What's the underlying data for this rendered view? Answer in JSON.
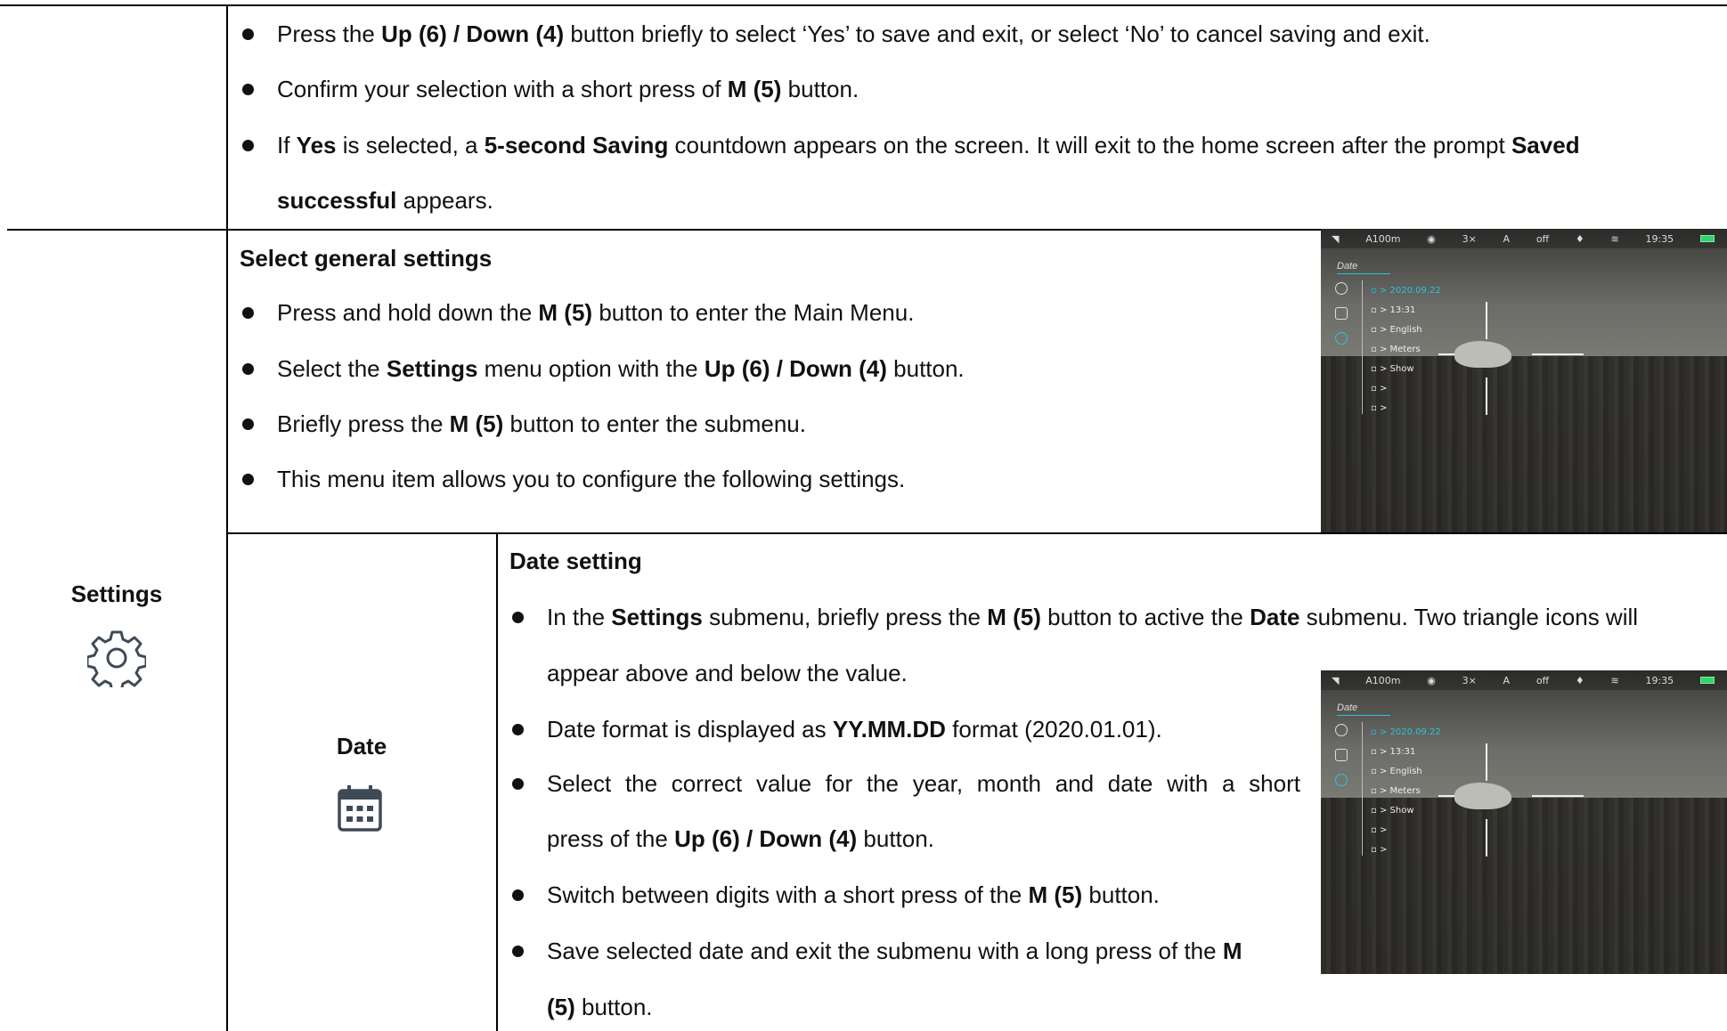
{
  "top_section": {
    "bullets": [
      [
        {
          "t": "Press the "
        },
        {
          "b": "Up (6) / Down (4)"
        },
        {
          "t": " button briefly to select ‘Yes’ to save and exit, or select ‘No’ to cancel saving and exit."
        }
      ],
      [
        {
          "t": "Confirm your selection with a short press of "
        },
        {
          "b": "M (5)"
        },
        {
          "t": " button."
        }
      ],
      [
        {
          "t": "If "
        },
        {
          "b": "Yes"
        },
        {
          "t": " is selected, a "
        },
        {
          "b": "5-second Saving"
        },
        {
          "t": " countdown appears on the screen. It will exit to the home screen after the prompt "
        },
        {
          "b": "Saved"
        }
      ],
      [
        {
          "b": "successful"
        },
        {
          "t": " appears."
        }
      ]
    ]
  },
  "settings_row": {
    "label": "Settings",
    "icon": "gear-icon",
    "general": {
      "heading": "Select general settings",
      "bullets": [
        [
          {
            "t": "Press and hold down the "
          },
          {
            "b": "M (5)"
          },
          {
            "t": " button to enter the Main Menu."
          }
        ],
        [
          {
            "t": "Select the "
          },
          {
            "b": "Settings"
          },
          {
            "t": " menu option with the "
          },
          {
            "b": "Up (6) / Down (4)"
          },
          {
            "t": " button."
          }
        ],
        [
          {
            "t": "Briefly press the "
          },
          {
            "b": "M (5)"
          },
          {
            "t": " button to enter the submenu."
          }
        ],
        [
          {
            "t": "This menu item allows you to configure the following settings."
          }
        ]
      ]
    }
  },
  "date_row": {
    "label": "Date",
    "icon": "calendar-icon",
    "heading": "Date setting",
    "bullets": [
      [
        {
          "t": "In the "
        },
        {
          "b": "Settings"
        },
        {
          "t": " submenu, briefly press the "
        },
        {
          "b": "M (5)"
        },
        {
          "t": " button to active the "
        },
        {
          "b": "Date"
        },
        {
          "t": " submenu. Two triangle icons will"
        }
      ],
      [
        {
          "t": "appear above and below the value."
        }
      ],
      [
        {
          "t": "Date format is displayed as "
        },
        {
          "b": "YY.MM.DD"
        },
        {
          "t": " format (2020.01.01)."
        }
      ],
      [
        {
          "t": "Select the correct value for the year, month and date with a short"
        }
      ],
      [
        {
          "t": "press of the "
        },
        {
          "b": "Up (6) / Down (4)"
        },
        {
          "t": " button."
        }
      ],
      [
        {
          "t": "Switch between digits with a short press of the "
        },
        {
          "b": "M (5)"
        },
        {
          "t": " button."
        }
      ],
      [
        {
          "t": "Save selected date and exit the submenu with a long press of the "
        },
        {
          "b": "M"
        }
      ],
      [
        {
          "b": "(5)"
        },
        {
          "t": " button."
        }
      ]
    ]
  },
  "screen": {
    "status": [
      "A100m",
      "3×",
      "A",
      "off",
      "19:35"
    ],
    "menu_title": "Date",
    "menu_items": [
      "> 2020.09.22",
      "> 13:31",
      "> English",
      "> Meters",
      "> Show",
      ">",
      ">"
    ],
    "accent_color": "#29c4d4"
  }
}
